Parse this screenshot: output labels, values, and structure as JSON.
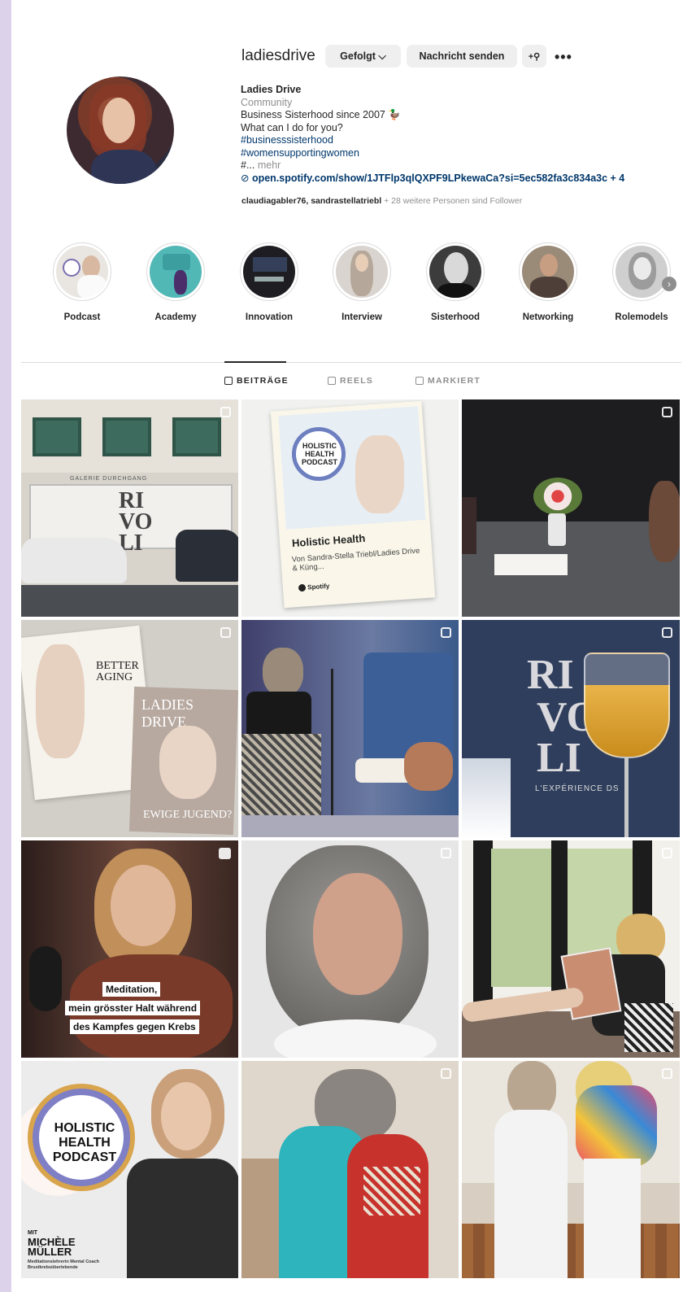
{
  "profile": {
    "username": "ladiesdrive",
    "follow_label": "Gefolgt ⌵",
    "message_label": "Nachricht senden",
    "add_icon": "+⚲",
    "more_icon": "•••",
    "display_name": "Ladies Drive",
    "category": "Community",
    "bio_line1": "Business Sisterhood since 2007 🦆",
    "bio_line2": "What can I do for you?",
    "hashtag1": "#businesssisterhood",
    "hashtag2": "#womensupportingwomen",
    "bio_more_prefix": "#...",
    "bio_more": "mehr",
    "link": "open.spotify.com/show/1JTFlp3qlQXPF9LPkewaCa?si=5ec582fa3c834a3c + 4",
    "followers_names": "claudiagabler76, sandrastellatriebl",
    "followers_suffix": " + 28 weitere Personen sind Follower"
  },
  "highlights": [
    {
      "label": "Podcast"
    },
    {
      "label": "Academy"
    },
    {
      "label": "Innovation"
    },
    {
      "label": "Interview"
    },
    {
      "label": "Sisterhood"
    },
    {
      "label": "Networking"
    },
    {
      "label": "Rolemodels"
    }
  ],
  "tabs": [
    {
      "label": "BEITRÄGE"
    },
    {
      "label": "REELS"
    },
    {
      "label": "MARKIERT"
    }
  ],
  "posts": {
    "p1_sign": "GALERIE DURCHGANG",
    "p1_logo": "RI VO LI",
    "p2_badge": "HOLISTIC HEALTH PODCAST",
    "p2_title": "Holistic Health",
    "p2_sub": "Von Sandra-Stella Triebl/Ladies Drive & Küng...",
    "p2_spotify": "Spotify",
    "p4_mag1": "BETTER AGING",
    "p4_mag2": "LADIES DRIVE",
    "p4_mag3": "EWIGE JUGEND?",
    "p6_logo1": "RI",
    "p6_logo2": "VO",
    "p6_logo3": "LI",
    "p6_sub": "L'EXPÉRIENCE DS",
    "p7_caption1": "Meditation,",
    "p7_caption2": "mein grösster Halt während",
    "p7_caption3": "des Kampfes gegen Krebs",
    "p10_badge1": "HOLISTIC",
    "p10_badge2": "HEALTH",
    "p10_badge3": "PODCAST",
    "p10_mit": "MIT",
    "p10_name1": "MICHÈLE",
    "p10_name2": "MÜLLER",
    "p10_role": "Meditationslehrerin Mental Coach Brustkrebsüberlebende"
  }
}
